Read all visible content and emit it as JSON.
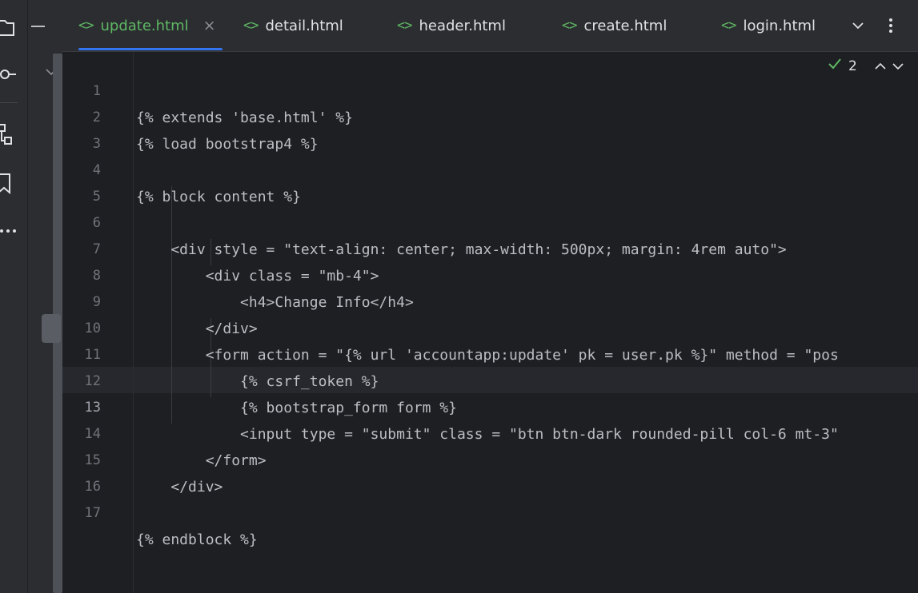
{
  "tabs": [
    {
      "label": "update.html",
      "active": true
    },
    {
      "label": "detail.html",
      "active": false
    },
    {
      "label": "header.html",
      "active": false
    },
    {
      "label": "create.html",
      "active": false
    },
    {
      "label": "login.html",
      "active": false
    }
  ],
  "tab_icon": "<>",
  "close_glyph": "×",
  "inspection": {
    "count": "2"
  },
  "editor": {
    "current_line": 13,
    "lines": [
      {
        "n": "1",
        "text": "{% extends 'base.html' %}"
      },
      {
        "n": "2",
        "text": "{% load bootstrap4 %}"
      },
      {
        "n": "3",
        "text": ""
      },
      {
        "n": "4",
        "text": "{% block content %}"
      },
      {
        "n": "5",
        "text": ""
      },
      {
        "n": "6",
        "text": "    <div style = \"text-align: center; max-width: 500px; margin: 4rem auto\">"
      },
      {
        "n": "7",
        "text": "        <div class = \"mb-4\">"
      },
      {
        "n": "8",
        "text": "            <h4>Change Info</h4>"
      },
      {
        "n": "9",
        "text": "        </div>"
      },
      {
        "n": "10",
        "text": "        <form action = \"{% url 'accountapp:update' pk = user.pk %}\" method = \"pos"
      },
      {
        "n": "11",
        "text": "            {% csrf_token %}"
      },
      {
        "n": "12",
        "text": "            {% bootstrap_form form %}"
      },
      {
        "n": "13",
        "text": "            <input type = \"submit\" class = \"btn btn-dark rounded-pill col-6 mt-3\""
      },
      {
        "n": "14",
        "text": "        </form>"
      },
      {
        "n": "15",
        "text": "    </div>"
      },
      {
        "n": "16",
        "text": ""
      },
      {
        "n": "17",
        "text": "{% endblock %}"
      }
    ]
  },
  "colors": {
    "background": "#1e1f22",
    "panel": "#2b2d30",
    "accent_green": "#5fb865",
    "tab_underline": "#3574f0",
    "tag_color": "#d5b778",
    "string_color": "#6aab73",
    "line_number": "#6f737a"
  },
  "icons": {
    "toolstrip": [
      "folder-icon",
      "commit-icon",
      "structure-icon",
      "bookmark-icon",
      "more-icon"
    ],
    "tab_icon": "html-tag-icon",
    "tab_close": "close-icon",
    "tab_overflow": "chevron-down-icon",
    "tab_menu": "kebab-menu-icon",
    "inspection": "check-icon",
    "nav": [
      "arrow-up-icon",
      "arrow-down-icon"
    ]
  }
}
